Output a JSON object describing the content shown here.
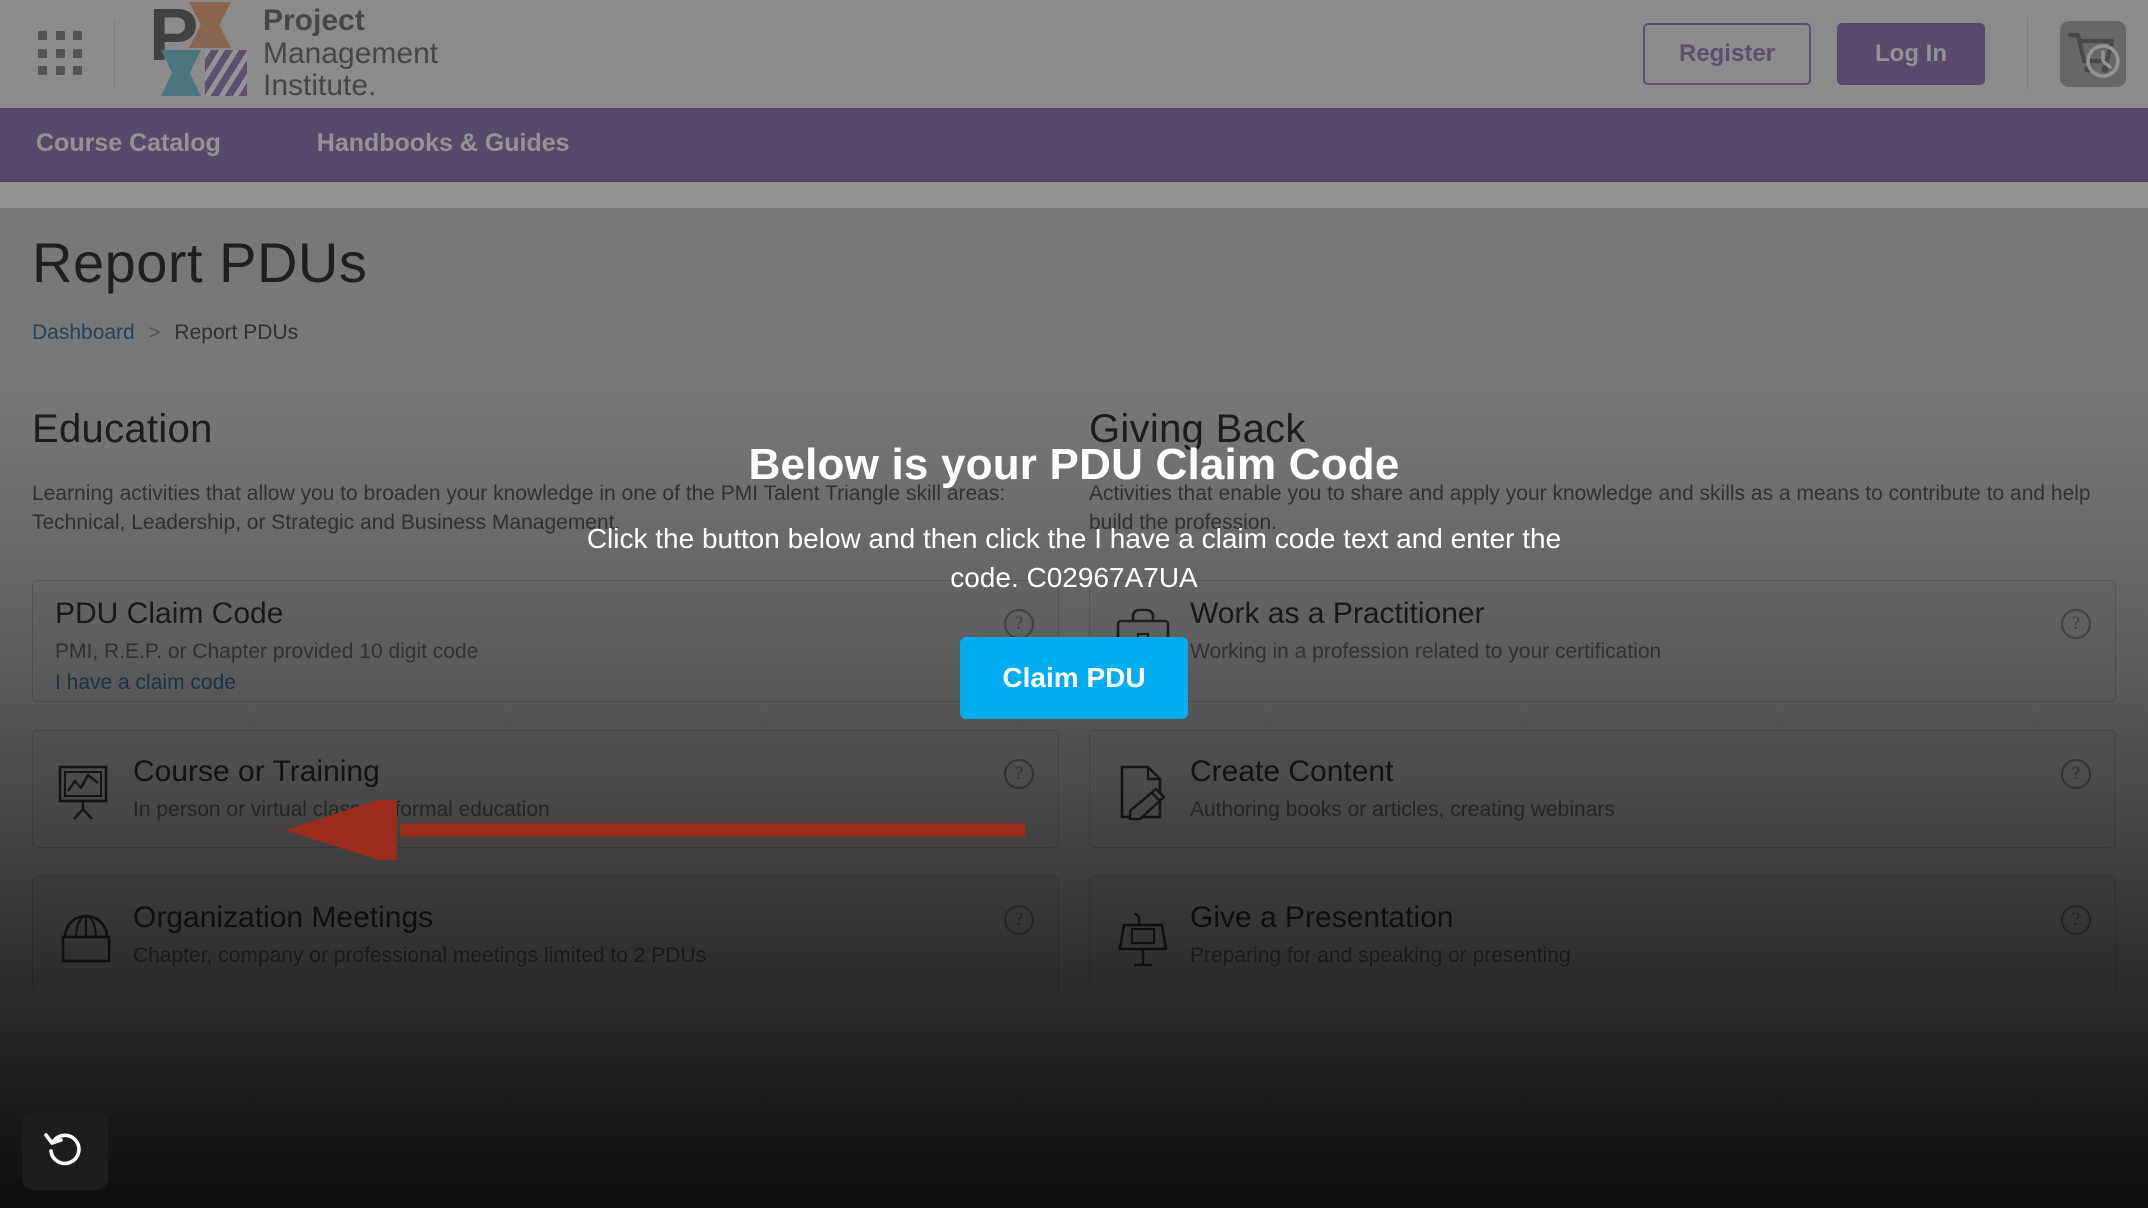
{
  "topbar": {
    "apps_icon": "apps-grid-icon",
    "logo": {
      "line1": "Project",
      "line2": "Management",
      "line3": "Institute."
    },
    "register_label": "Register",
    "login_label": "Log In",
    "cart_icon": "cart-clock-icon"
  },
  "nav": {
    "items": [
      {
        "label": "Course Catalog"
      },
      {
        "label": "Handbooks & Guides"
      }
    ]
  },
  "page": {
    "title": "Report PDUs",
    "breadcrumb": {
      "home": "Dashboard",
      "separator": ">",
      "current": "Report PDUs"
    }
  },
  "education": {
    "heading": "Education",
    "description": "Learning activities that allow you to broaden your knowledge in one of the PMI Talent Triangle skill areas: Technical, Leadership, or Strategic and Business Management.",
    "cards": [
      {
        "title": "PDU Claim Code",
        "subtitle": "PMI, R.E.P. or Chapter provided 10 digit code",
        "link": "I have a claim code",
        "icon": "none",
        "help": "?"
      },
      {
        "title": "Course or Training",
        "subtitle": "In person or virtual classes, formal education",
        "icon": "presentation-board-icon",
        "help": "?"
      },
      {
        "title": "Organization Meetings",
        "subtitle": "Chapter, company or professional meetings limited to 2 PDUs",
        "icon": "meeting-icon",
        "help": "?"
      }
    ]
  },
  "giving_back": {
    "heading": "Giving Back",
    "description": "Activities that enable you to share and apply your knowledge and skills as a means to contribute to and help build the profession.",
    "cards": [
      {
        "title": "Work as a Practitioner",
        "subtitle": "Working in a profession related to your certification",
        "icon": "briefcase-icon",
        "help": "?"
      },
      {
        "title": "Create Content",
        "subtitle": "Authoring books or articles, creating webinars",
        "icon": "document-pencil-icon",
        "help": "?"
      },
      {
        "title": "Give a Presentation",
        "subtitle": "Preparing for and speaking or presenting",
        "icon": "podium-icon",
        "help": "?"
      }
    ]
  },
  "modal": {
    "title": "Below is your PDU Claim Code",
    "body": "Click the button below and then click the I have a claim code text and enter the code. C02967A7UA",
    "claim_code": "C02967A7UA",
    "button_label": "Claim PDU"
  },
  "annotation": {
    "arrow": "red-left-arrow",
    "points_to": "I have a claim code"
  },
  "undo": {
    "icon": "undo-rotate-icon"
  },
  "colors": {
    "nav_purple": "#41197F",
    "login_purple": "#4B1A86",
    "register_border": "#5B2D91",
    "accent_blue": "#00ADEE",
    "link_blue": "#2A7AB0",
    "arrow_red": "#9B2C1C"
  }
}
